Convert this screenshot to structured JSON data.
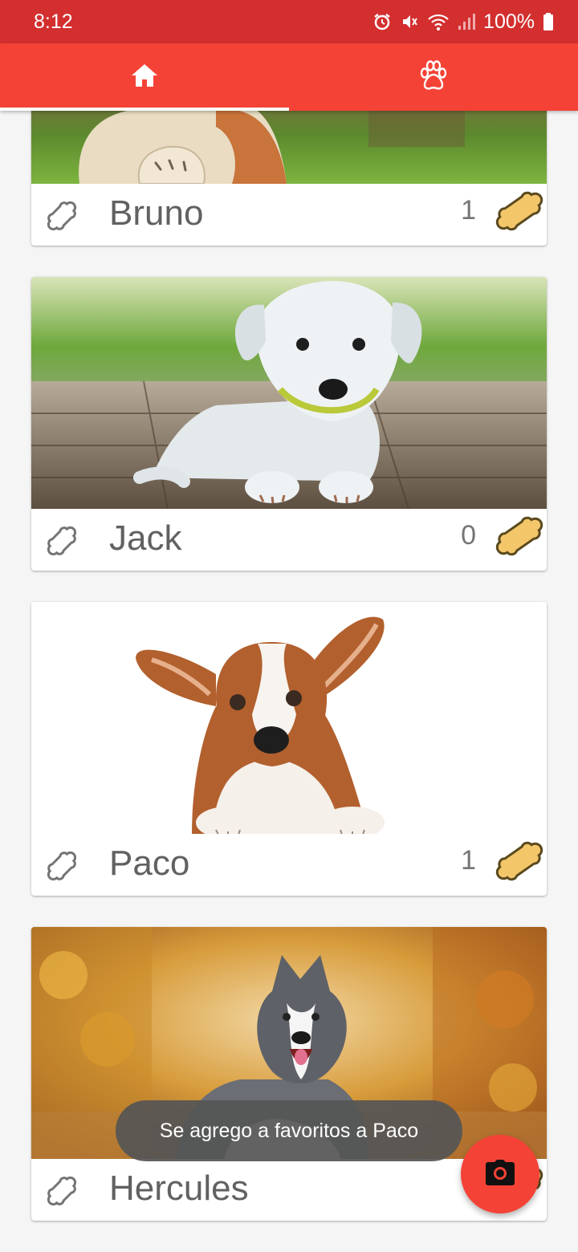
{
  "status_bar": {
    "time": "8:12",
    "battery": "100%",
    "icons": [
      "alarm-icon",
      "mute-icon",
      "wifi-icon",
      "signal-icon",
      "battery-icon"
    ]
  },
  "tabs": [
    {
      "icon": "home-icon",
      "selected": true
    },
    {
      "icon": "paw-icon",
      "selected": false
    }
  ],
  "pets": [
    {
      "name": "Bruno",
      "likes": "1",
      "photo": "photo-bruno"
    },
    {
      "name": "Jack",
      "likes": "0",
      "photo": "photo-jack"
    },
    {
      "name": "Paco",
      "likes": "1",
      "photo": "photo-paco"
    },
    {
      "name": "Hercules",
      "likes": "",
      "photo": "photo-hercules"
    }
  ],
  "toast": {
    "text": "Se agrego a favoritos a Paco"
  },
  "fab": {
    "icon": "camera-icon"
  },
  "colors": {
    "status_bar": "#d32f2f",
    "primary": "#f44336",
    "bone": "#f4c66a",
    "text": "#616161"
  }
}
